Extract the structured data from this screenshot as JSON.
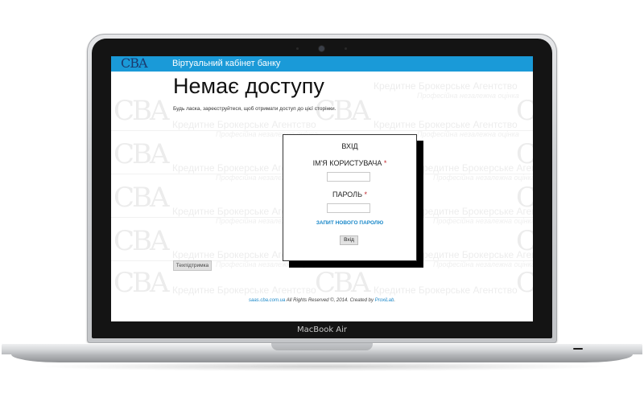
{
  "device": {
    "brand_label": "MacBook Air"
  },
  "header": {
    "logo": "CBA",
    "title": "Віртуальний кабінет банку",
    "accent": "#1a9ad8"
  },
  "page": {
    "title": "Немає доступу",
    "subtitle": "Будь ласка, зареєструйтеся, щоб отримати доступ до цієї сторінки."
  },
  "login": {
    "heading": "ВХІД",
    "username_label": "ІМ'Я КОРИСТУВАЧА",
    "password_label": "ПАРОЛЬ",
    "required_mark": "*",
    "username_value": "",
    "password_value": "",
    "forgot_link": "ЗАПИТ НОВОГО ПАРОЛЮ",
    "submit_label": "Вхід"
  },
  "support_button": "Техпідтримка",
  "footer": {
    "site_link": "saas.cba.com.ua",
    "rights": " All Rights Reserved ©, 2014. Created by ",
    "creator_link": "ProxiLab",
    "end": "."
  },
  "watermark": {
    "logo": "CBA",
    "text": "Кредитне Брокерське Агентство",
    "subtext": "Професійна незалежна оцінка"
  }
}
